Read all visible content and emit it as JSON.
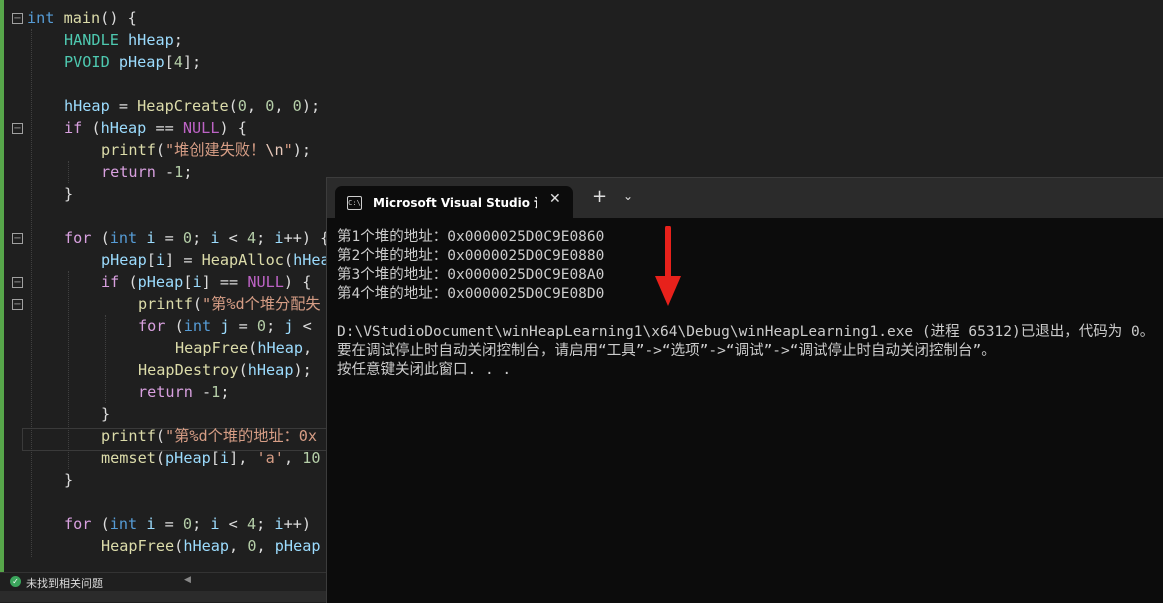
{
  "editor": {
    "lines": [
      {
        "indent": 0,
        "parts": [
          {
            "c": "kw",
            "t": "int"
          },
          {
            "c": "",
            "t": " "
          },
          {
            "c": "fn2",
            "t": "main"
          },
          {
            "c": "",
            "t": "() {"
          }
        ]
      },
      {
        "indent": 1,
        "parts": [
          {
            "c": "ty",
            "t": "HANDLE"
          },
          {
            "c": "",
            "t": " "
          },
          {
            "c": "var",
            "t": "hHeap"
          },
          {
            "c": "",
            "t": ";"
          }
        ]
      },
      {
        "indent": 1,
        "parts": [
          {
            "c": "ty",
            "t": "PVOID"
          },
          {
            "c": "",
            "t": " "
          },
          {
            "c": "var",
            "t": "pHeap"
          },
          {
            "c": "",
            "t": "["
          },
          {
            "c": "num",
            "t": "4"
          },
          {
            "c": "",
            "t": "];"
          }
        ]
      },
      {
        "indent": 0,
        "parts": []
      },
      {
        "indent": 1,
        "parts": [
          {
            "c": "var",
            "t": "hHeap"
          },
          {
            "c": "",
            "t": " = "
          },
          {
            "c": "fn",
            "t": "HeapCreate"
          },
          {
            "c": "",
            "t": "("
          },
          {
            "c": "num",
            "t": "0"
          },
          {
            "c": "",
            "t": ", "
          },
          {
            "c": "num",
            "t": "0"
          },
          {
            "c": "",
            "t": ", "
          },
          {
            "c": "num",
            "t": "0"
          },
          {
            "c": "",
            "t": ");"
          }
        ]
      },
      {
        "indent": 1,
        "parts": [
          {
            "c": "kw2",
            "t": "if"
          },
          {
            "c": "",
            "t": " ("
          },
          {
            "c": "var",
            "t": "hHeap"
          },
          {
            "c": "",
            "t": " == "
          },
          {
            "c": "mac",
            "t": "NULL"
          },
          {
            "c": "",
            "t": ") {"
          }
        ]
      },
      {
        "indent": 2,
        "parts": [
          {
            "c": "fn",
            "t": "printf"
          },
          {
            "c": "",
            "t": "("
          },
          {
            "c": "str",
            "t": "\"堆创建失败！"
          },
          {
            "c": "esc",
            "t": "\\n"
          },
          {
            "c": "str",
            "t": "\""
          },
          {
            "c": "",
            "t": ");"
          }
        ]
      },
      {
        "indent": 2,
        "parts": [
          {
            "c": "kw2",
            "t": "return"
          },
          {
            "c": "",
            "t": " -"
          },
          {
            "c": "num",
            "t": "1"
          },
          {
            "c": "",
            "t": ";"
          }
        ]
      },
      {
        "indent": 1,
        "parts": [
          {
            "c": "",
            "t": "}"
          }
        ]
      },
      {
        "indent": 0,
        "parts": []
      },
      {
        "indent": 1,
        "parts": [
          {
            "c": "kw2",
            "t": "for"
          },
          {
            "c": "",
            "t": " ("
          },
          {
            "c": "kw",
            "t": "int"
          },
          {
            "c": "",
            "t": " "
          },
          {
            "c": "var",
            "t": "i"
          },
          {
            "c": "",
            "t": " = "
          },
          {
            "c": "num",
            "t": "0"
          },
          {
            "c": "",
            "t": "; "
          },
          {
            "c": "var",
            "t": "i"
          },
          {
            "c": "",
            "t": " < "
          },
          {
            "c": "num",
            "t": "4"
          },
          {
            "c": "",
            "t": "; "
          },
          {
            "c": "var",
            "t": "i"
          },
          {
            "c": "",
            "t": "++) {"
          }
        ]
      },
      {
        "indent": 2,
        "parts": [
          {
            "c": "var",
            "t": "pHeap"
          },
          {
            "c": "",
            "t": "["
          },
          {
            "c": "var",
            "t": "i"
          },
          {
            "c": "",
            "t": "] = "
          },
          {
            "c": "fn",
            "t": "HeapAlloc"
          },
          {
            "c": "",
            "t": "("
          },
          {
            "c": "var",
            "t": "hHeap"
          }
        ]
      },
      {
        "indent": 2,
        "parts": [
          {
            "c": "kw2",
            "t": "if"
          },
          {
            "c": "",
            "t": " ("
          },
          {
            "c": "var",
            "t": "pHeap"
          },
          {
            "c": "",
            "t": "["
          },
          {
            "c": "var",
            "t": "i"
          },
          {
            "c": "",
            "t": "] == "
          },
          {
            "c": "mac",
            "t": "NULL"
          },
          {
            "c": "",
            "t": ") {"
          }
        ]
      },
      {
        "indent": 3,
        "parts": [
          {
            "c": "fn",
            "t": "printf"
          },
          {
            "c": "",
            "t": "("
          },
          {
            "c": "str",
            "t": "\"第%d个堆分配失"
          }
        ]
      },
      {
        "indent": 3,
        "parts": [
          {
            "c": "kw2",
            "t": "for"
          },
          {
            "c": "",
            "t": " ("
          },
          {
            "c": "kw",
            "t": "int"
          },
          {
            "c": "",
            "t": " "
          },
          {
            "c": "var",
            "t": "j"
          },
          {
            "c": "",
            "t": " = "
          },
          {
            "c": "num",
            "t": "0"
          },
          {
            "c": "",
            "t": "; "
          },
          {
            "c": "var",
            "t": "j"
          },
          {
            "c": "",
            "t": " < "
          }
        ]
      },
      {
        "indent": 4,
        "parts": [
          {
            "c": "fn",
            "t": "HeapFree"
          },
          {
            "c": "",
            "t": "("
          },
          {
            "c": "var",
            "t": "hHeap"
          },
          {
            "c": "",
            "t": ", "
          }
        ]
      },
      {
        "indent": 3,
        "parts": [
          {
            "c": "fn",
            "t": "HeapDestroy"
          },
          {
            "c": "",
            "t": "("
          },
          {
            "c": "var",
            "t": "hHeap"
          },
          {
            "c": "",
            "t": ");"
          }
        ]
      },
      {
        "indent": 3,
        "parts": [
          {
            "c": "kw2",
            "t": "return"
          },
          {
            "c": "",
            "t": " -"
          },
          {
            "c": "num",
            "t": "1"
          },
          {
            "c": "",
            "t": ";"
          }
        ]
      },
      {
        "indent": 2,
        "parts": [
          {
            "c": "",
            "t": "}"
          }
        ]
      },
      {
        "indent": 2,
        "parts": [
          {
            "c": "fn",
            "t": "printf"
          },
          {
            "c": "",
            "t": "("
          },
          {
            "c": "str",
            "t": "\"第%d个堆的地址：0x"
          }
        ]
      },
      {
        "indent": 2,
        "parts": [
          {
            "c": "fn",
            "t": "memset"
          },
          {
            "c": "",
            "t": "("
          },
          {
            "c": "var",
            "t": "pHeap"
          },
          {
            "c": "",
            "t": "["
          },
          {
            "c": "var",
            "t": "i"
          },
          {
            "c": "",
            "t": "], "
          },
          {
            "c": "str",
            "t": "'a'"
          },
          {
            "c": "",
            "t": ", "
          },
          {
            "c": "num",
            "t": "10"
          }
        ]
      },
      {
        "indent": 1,
        "parts": [
          {
            "c": "",
            "t": "}"
          }
        ]
      },
      {
        "indent": 0,
        "parts": []
      },
      {
        "indent": 1,
        "parts": [
          {
            "c": "kw2",
            "t": "for"
          },
          {
            "c": "",
            "t": " ("
          },
          {
            "c": "kw",
            "t": "int"
          },
          {
            "c": "",
            "t": " "
          },
          {
            "c": "var",
            "t": "i"
          },
          {
            "c": "",
            "t": " = "
          },
          {
            "c": "num",
            "t": "0"
          },
          {
            "c": "",
            "t": "; "
          },
          {
            "c": "var",
            "t": "i"
          },
          {
            "c": "",
            "t": " < "
          },
          {
            "c": "num",
            "t": "4"
          },
          {
            "c": "",
            "t": "; "
          },
          {
            "c": "var",
            "t": "i"
          },
          {
            "c": "",
            "t": "++)"
          }
        ]
      },
      {
        "indent": 2,
        "parts": [
          {
            "c": "fn",
            "t": "HeapFree"
          },
          {
            "c": "",
            "t": "("
          },
          {
            "c": "var",
            "t": "hHeap"
          },
          {
            "c": "",
            "t": ", "
          },
          {
            "c": "num",
            "t": "0"
          },
          {
            "c": "",
            "t": ", "
          },
          {
            "c": "var",
            "t": "pHeap"
          }
        ]
      }
    ],
    "fold_markers": [
      0,
      5,
      10,
      12,
      13
    ],
    "colors": {
      "background": "#1f1f1f",
      "keyword": "#569cd6",
      "control": "#d8a0df",
      "type": "#4ec9b0",
      "variable": "#9cdcfe",
      "function": "#dcdcaa",
      "string": "#d69d85",
      "number": "#b5cea8",
      "macro": "#bd63c5",
      "change_bar": "#57a64a"
    }
  },
  "statusbar": {
    "icon": "check-circle-icon",
    "text": "未找到相关问题"
  },
  "console": {
    "tab_title": "Microsoft Visual Studio 调试控制台",
    "close_label": "✕",
    "new_tab_label": "+",
    "dropdown_label": "⌄",
    "lines": [
      "第1个堆的地址：0x0000025D0C9E0860",
      "第2个堆的地址：0x0000025D0C9E0880",
      "第3个堆的地址：0x0000025D0C9E08A0",
      "第4个堆的地址：0x0000025D0C9E08D0",
      "",
      "D:\\VStudioDocument\\winHeapLearning1\\x64\\Debug\\winHeapLearning1.exe (进程 65312)已退出，代码为 0。",
      "要在调试停止时自动关闭控制台，请启用“工具”->“选项”->“调试”->“调试停止时自动关闭控制台”。",
      "按任意键关闭此窗口. . ."
    ],
    "annotation": {
      "icon": "red-down-arrow-icon",
      "color": "#e8211b"
    }
  }
}
